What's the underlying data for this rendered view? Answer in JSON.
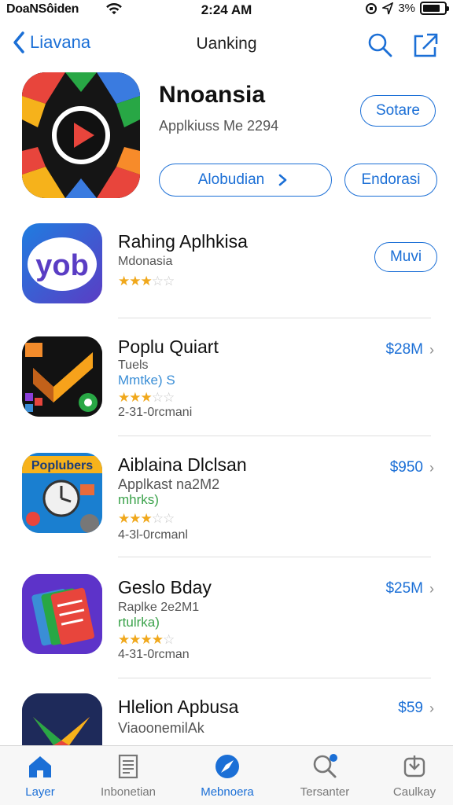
{
  "status": {
    "carrier": "DoaNSôiden",
    "time": "2:24 AM",
    "battery": "3%"
  },
  "nav": {
    "back_label": "Liavana",
    "title": "Uanking"
  },
  "featured": {
    "name": "Nnoansia",
    "subtitle": "Applkiuss Me 2294",
    "button_top": "Sotare",
    "button_primary": "Alobudian",
    "button_secondary": "Endorasi"
  },
  "apps": [
    {
      "name": "Rahing Aplhkisa",
      "line1": "Mdonasia",
      "rating": 3,
      "action": "Muvi"
    },
    {
      "name": "Poplu Quiart",
      "line1": "Tuels",
      "tag": "Mmtke) S",
      "rating": 3,
      "line2": "2-31-0rcmani",
      "price": "$28M"
    },
    {
      "name": "Aiblaina Dlclsan",
      "line1": "Applkast na2M2",
      "tag": "mhrks)",
      "rating": 3,
      "line2": "4-3l-0rcmanl",
      "price": "$950"
    },
    {
      "name": "Geslo Bday",
      "line1": "Raplke 2e2M1",
      "tag": "rtulrka)",
      "rating": 4,
      "line2": "4-31-0rcman",
      "price": "$25M"
    },
    {
      "name": "Hlelion Apbusa",
      "line1": "ViaoonemilAk",
      "price": "$59"
    }
  ],
  "tabs": [
    {
      "label": "Layer",
      "icon": "home-icon"
    },
    {
      "label": "Inbonetian",
      "icon": "document-icon"
    },
    {
      "label": "Mebnoera",
      "icon": "compass-icon"
    },
    {
      "label": "Tersanter",
      "icon": "search-icon"
    },
    {
      "label": "Caulkay",
      "icon": "download-icon"
    }
  ],
  "colors": {
    "accent": "#1b6fd6",
    "star": "#f0a81c",
    "tag_green": "#3aa24a"
  }
}
